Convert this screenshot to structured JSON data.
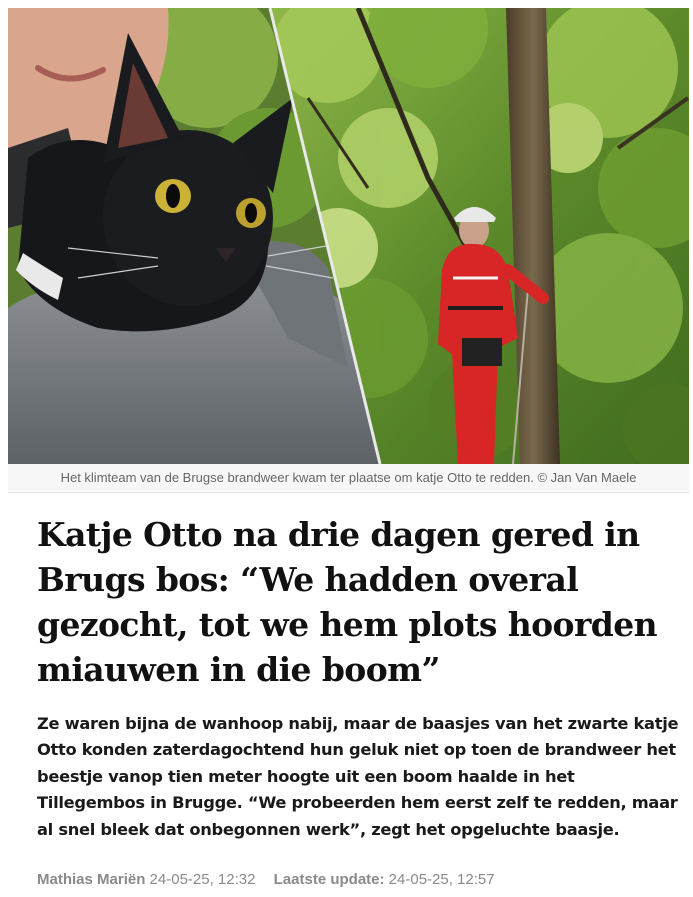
{
  "photo": {
    "left_alt": "",
    "right_alt": ""
  },
  "caption": {
    "text": "Het klimteam van de Brugse brandweer kwam ter plaatse om katje Otto te redden. © Jan Van Maele"
  },
  "article": {
    "headline": "Katje Otto na drie dagen gered in Brugs bos: “We hadden overal gezocht, tot we hem plots hoorden miauwen in die boom”",
    "lead": "Ze waren bijna de wanhoop nabij, maar de baasjes van het zwarte katje Otto konden zaterdagochtend hun geluk niet op toen de brandweer het beestje vanop tien meter hoogte uit een boom haalde in het Tillegembos in Brugge. “We probeerden hem eerst zelf te redden, maar al snel bleek dat onbegonnen werk”, zegt het opgeluchte baasje.",
    "author": "Mathias Mariën",
    "published": "24-05-25, 12:32",
    "updated_label": "Laatste update:",
    "updated": "24-05-25, 12:57"
  }
}
